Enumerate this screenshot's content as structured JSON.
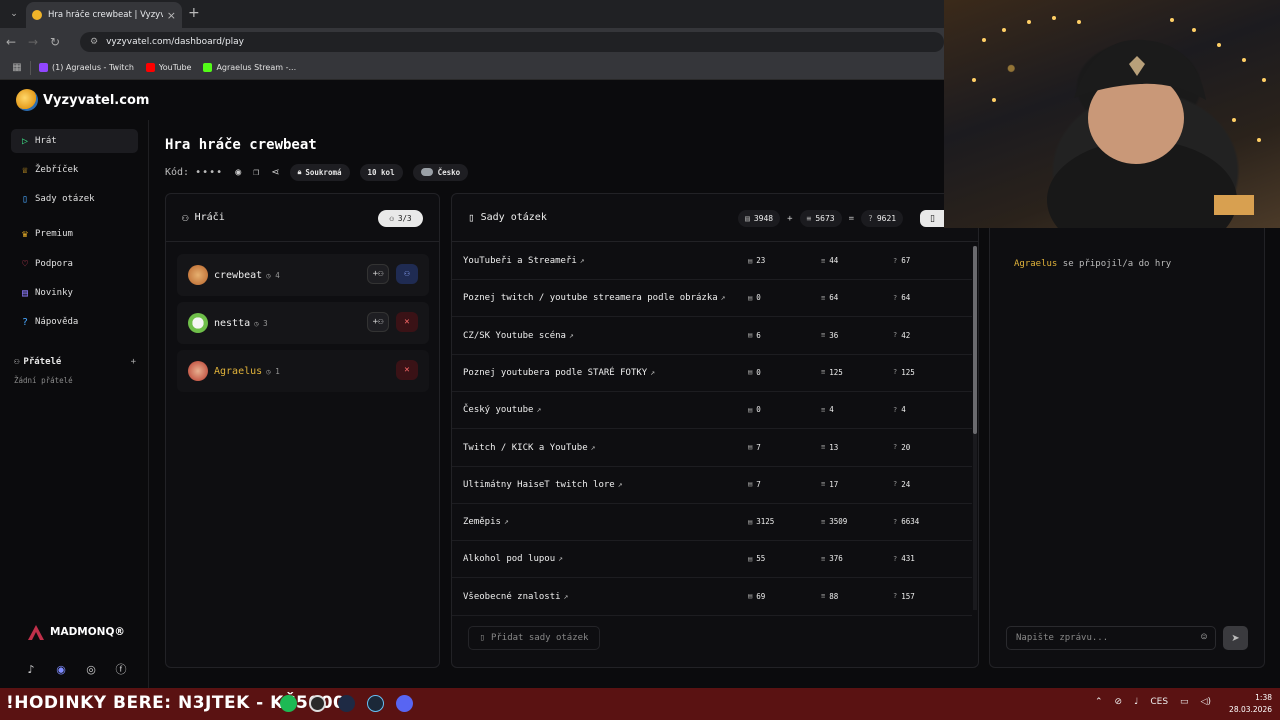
{
  "browser": {
    "tab_title": "Hra hráče crewbeat | Vyzyvatel.com",
    "url": "vyzyvatel.com/dashboard/play",
    "bookmarks": [
      {
        "label": "(1) Agraelus - Twitch",
        "color": "#9146ff"
      },
      {
        "label": "YouTube",
        "color": "#ff0000"
      },
      {
        "label": "Agraelus Stream -...",
        "color": "#53fc18"
      }
    ]
  },
  "app": {
    "logo": "Vyzyvatel.com"
  },
  "sidebar": {
    "items": [
      {
        "label": "Hrát",
        "icon": "play-icon",
        "color": "#3ddc84"
      },
      {
        "label": "Žebříček",
        "icon": "trophy-icon",
        "color": "#f0b429"
      },
      {
        "label": "Sady otázek",
        "icon": "book-icon",
        "color": "#4aa8ff"
      },
      {
        "label": "Premium",
        "icon": "crown-icon",
        "color": "#f0b429"
      },
      {
        "label": "Podpora",
        "icon": "heart-icon",
        "color": "#ff4d6d"
      },
      {
        "label": "Novinky",
        "icon": "news-icon",
        "color": "#8f7cff"
      },
      {
        "label": "Nápověda",
        "icon": "help-icon",
        "color": "#4aa8ff"
      }
    ],
    "friends_title": "Přátelé",
    "friends_empty": "Žádní přátelé",
    "sponsor": "MADMONQ®"
  },
  "game": {
    "title": "Hra hráče crewbeat",
    "code_label": "Kód:",
    "code_masked": "••••",
    "privacy": "Soukromá",
    "rounds": "10 kol",
    "region": "Česko"
  },
  "players": {
    "title": "Hráči",
    "count": "3/3",
    "list": [
      {
        "name": "crewbeat",
        "level": "4",
        "name_color": "#eeeeee",
        "avatar": "#d98a3a"
      },
      {
        "name": "nestta",
        "level": "3",
        "name_color": "#eeeeee",
        "avatar": "#6fbf4a"
      },
      {
        "name": "Agraelus",
        "level": "1",
        "name_color": "#e0b23a",
        "avatar": "#b83a2e"
      }
    ]
  },
  "question_sets": {
    "title": "Sady otázek",
    "total_a": "3948",
    "total_b": "5673",
    "total_sum": "9621",
    "op_plus": "+",
    "op_eq": "=",
    "add_label": "Přidat sady otázek",
    "rows": [
      {
        "name": "YouTubeři a Streameři",
        "a": "23",
        "b": "44",
        "c": "67"
      },
      {
        "name": "Poznej twitch / youtube streamera podle obrázka",
        "a": "0",
        "b": "64",
        "c": "64"
      },
      {
        "name": "CZ/SK Youtube scéna",
        "a": "6",
        "b": "36",
        "c": "42"
      },
      {
        "name": "Poznej youtubera podle STARÉ FOTKY",
        "a": "0",
        "b": "125",
        "c": "125"
      },
      {
        "name": "Český youtube",
        "a": "0",
        "b": "4",
        "c": "4"
      },
      {
        "name": "Twitch / KICK a YouTube",
        "a": "7",
        "b": "13",
        "c": "20"
      },
      {
        "name": "Ultimátny HaiseT twitch lore",
        "a": "7",
        "b": "17",
        "c": "24"
      },
      {
        "name": "Zeměpis",
        "a": "3125",
        "b": "3509",
        "c": "6634"
      },
      {
        "name": "Alkohol pod lupou",
        "a": "55",
        "b": "376",
        "c": "431"
      },
      {
        "name": "Všeobecné znalosti",
        "a": "69",
        "b": "88",
        "c": "157"
      }
    ]
  },
  "chat": {
    "message_user": "Agraelus",
    "message_text": "se připojil/a do hry",
    "placeholder": "Napište zprávu..."
  },
  "taskbar": {
    "ticker": "!HODINKY BERE: N3JTEK - KČ5000",
    "lang": "CES",
    "time": "1:38",
    "date": "28.03.2026"
  }
}
